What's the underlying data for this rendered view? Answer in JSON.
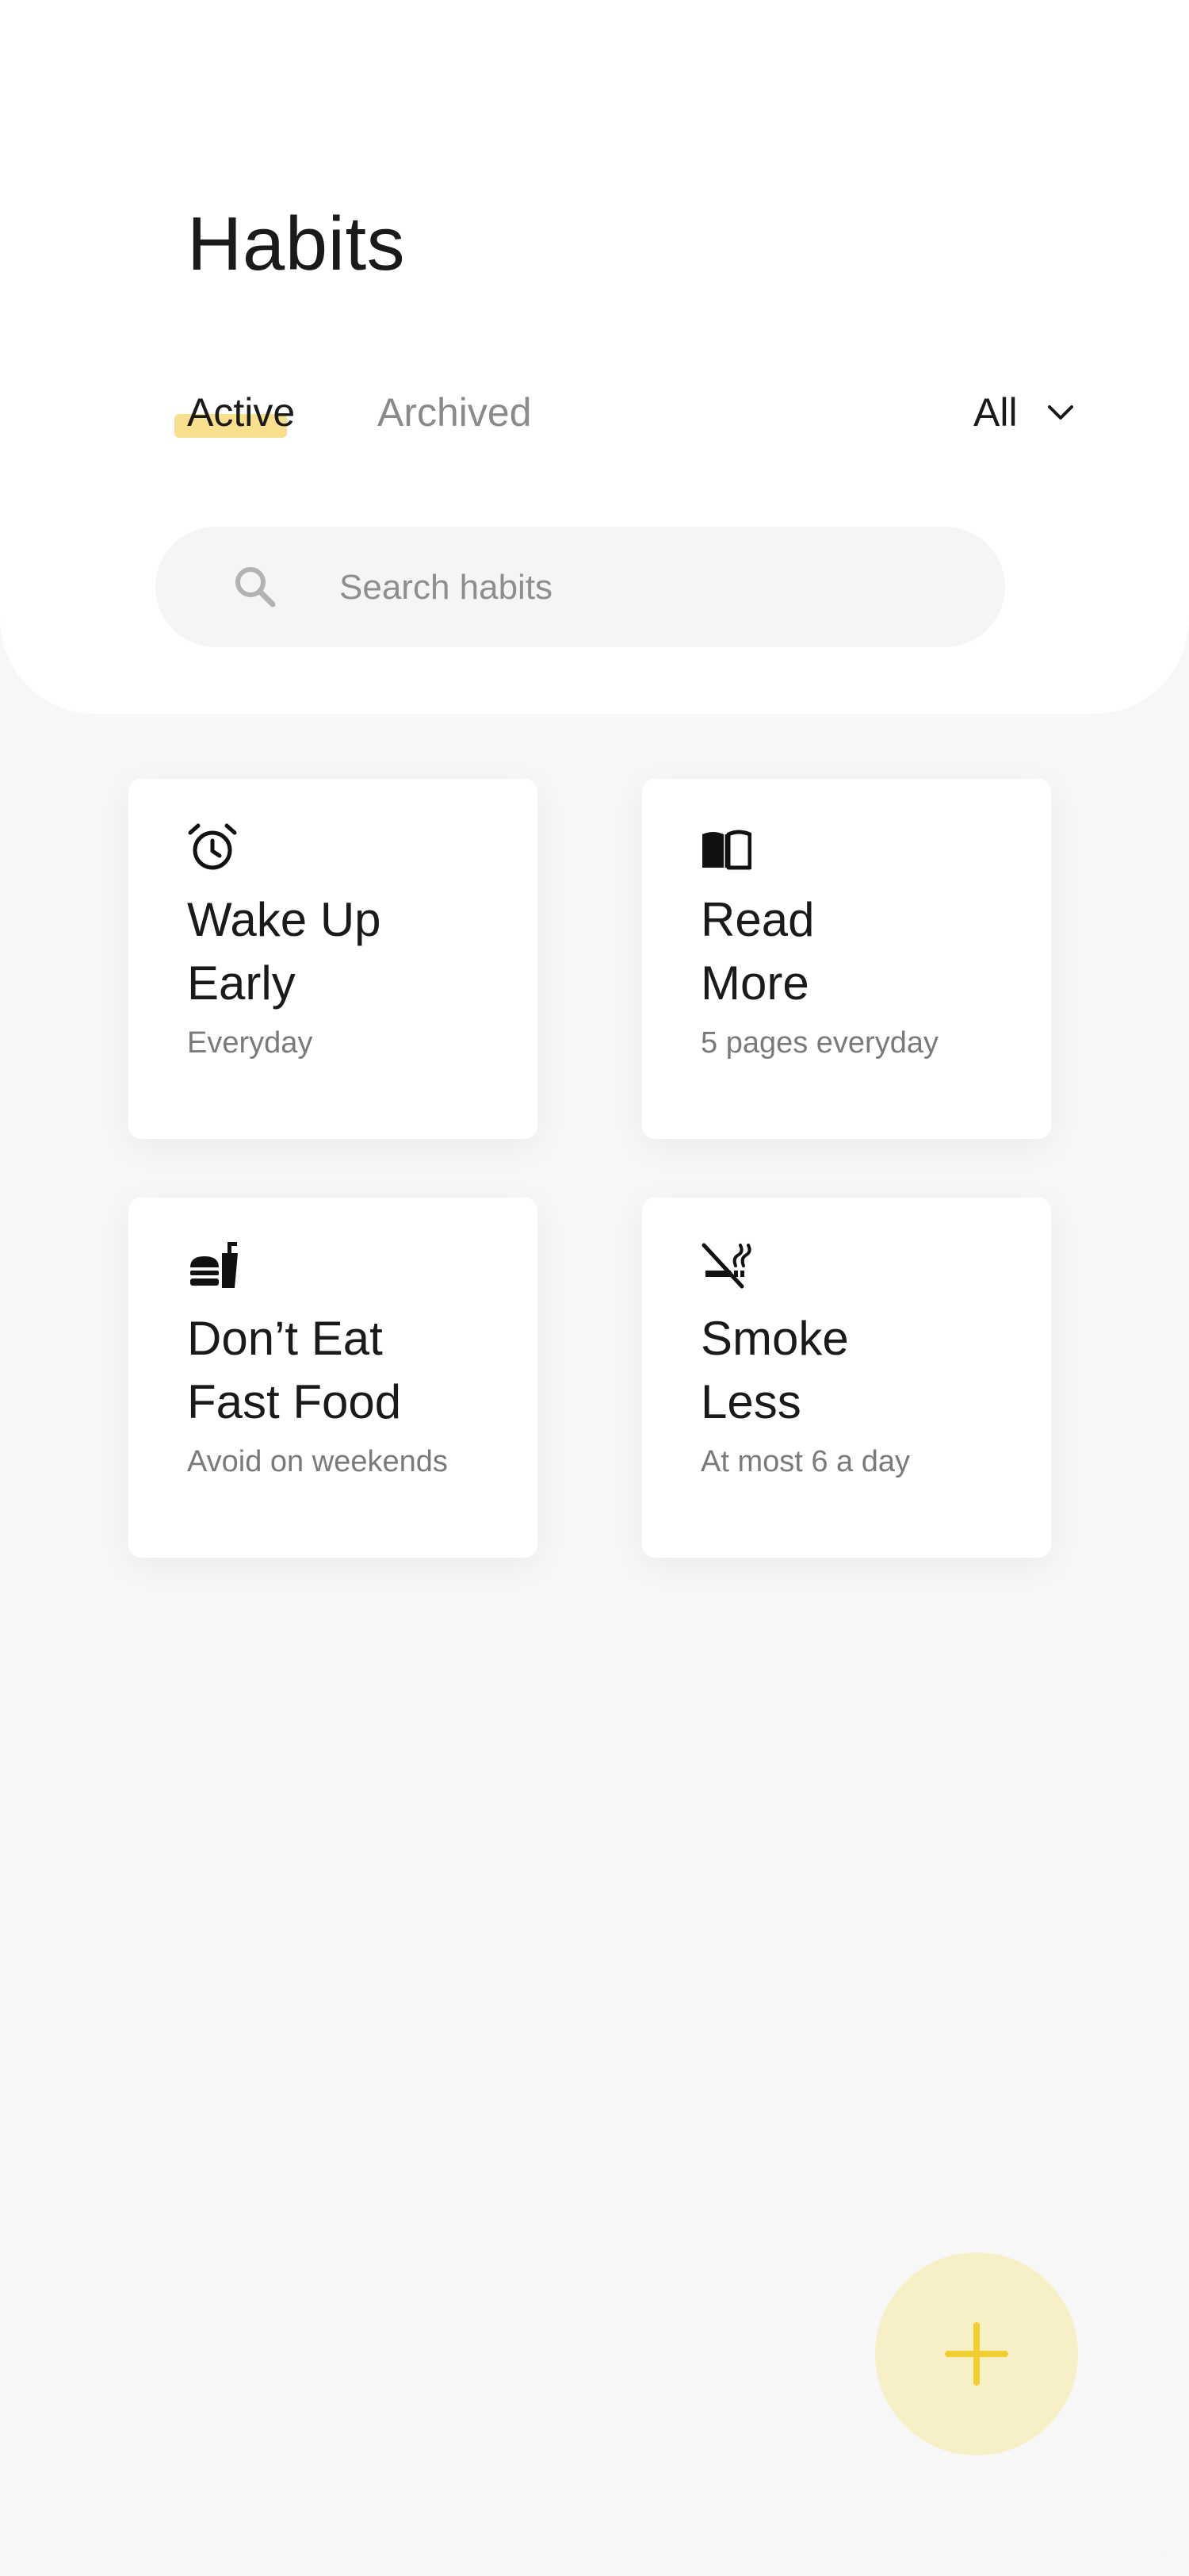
{
  "header": {
    "title": "Habits"
  },
  "tabs": [
    {
      "label": "Active",
      "active": true
    },
    {
      "label": "Archived",
      "active": false
    }
  ],
  "filter": {
    "selected": "All",
    "icon": "chevron-down-icon"
  },
  "search": {
    "placeholder": "Search habits",
    "value": "",
    "icon": "search-icon"
  },
  "habits": [
    {
      "icon": "alarm-clock-icon",
      "title_line1": "Wake Up",
      "title_line2": "Early",
      "subtitle": "Everyday"
    },
    {
      "icon": "book-icon",
      "title_line1": "Read",
      "title_line2": "More",
      "subtitle": "5 pages everyday"
    },
    {
      "icon": "fast-food-icon",
      "title_line1": "Don’t Eat",
      "title_line2": "Fast Food",
      "subtitle": "Avoid on weekends"
    },
    {
      "icon": "no-smoking-icon",
      "title_line1": "Smoke",
      "title_line2": "Less",
      "subtitle": "At most 6 a day"
    }
  ],
  "fab": {
    "icon": "plus-icon"
  },
  "colors": {
    "accent": "#f8e08e",
    "accent_fab_bg": "#f7efc6",
    "accent_plus": "#f1cf33",
    "background": "#f7f7f7",
    "surface": "#ffffff",
    "text_primary": "#1a1a1a",
    "text_secondary": "#7a7a7a"
  }
}
